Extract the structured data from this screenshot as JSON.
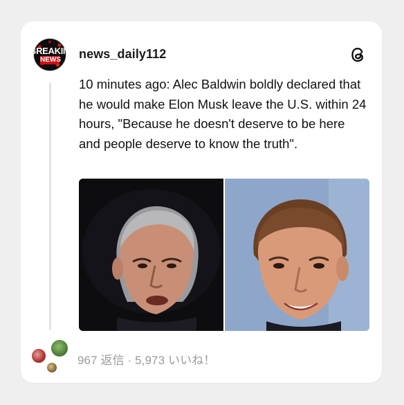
{
  "post": {
    "username": "news_daily112",
    "avatar_text_top": "BREAKING",
    "avatar_text_bottom": "NEWS",
    "text": "10 minutes ago: Alec Baldwin boldly declared that he would make Elon Musk leave the U.S. within 24 hours, \"Because he doesn't deserve to be here and people deserve to know the truth\".",
    "app_logo_icon": "threads-logo-icon",
    "media": [
      {
        "icon": "photo-alec-baldwin",
        "background": "#0d0d10"
      },
      {
        "icon": "photo-elon-musk",
        "background": "#8ea6c9"
      }
    ]
  },
  "stats": {
    "replies": "967 返信",
    "separator": "·",
    "likes": "5,973 いいね！"
  },
  "colors": {
    "page_background": "#efefef",
    "card_background": "#ffffff",
    "text": "#111111",
    "muted": "#9a9a9a",
    "thread_line": "#e2e2e2",
    "breaking_red": "#d01010"
  }
}
